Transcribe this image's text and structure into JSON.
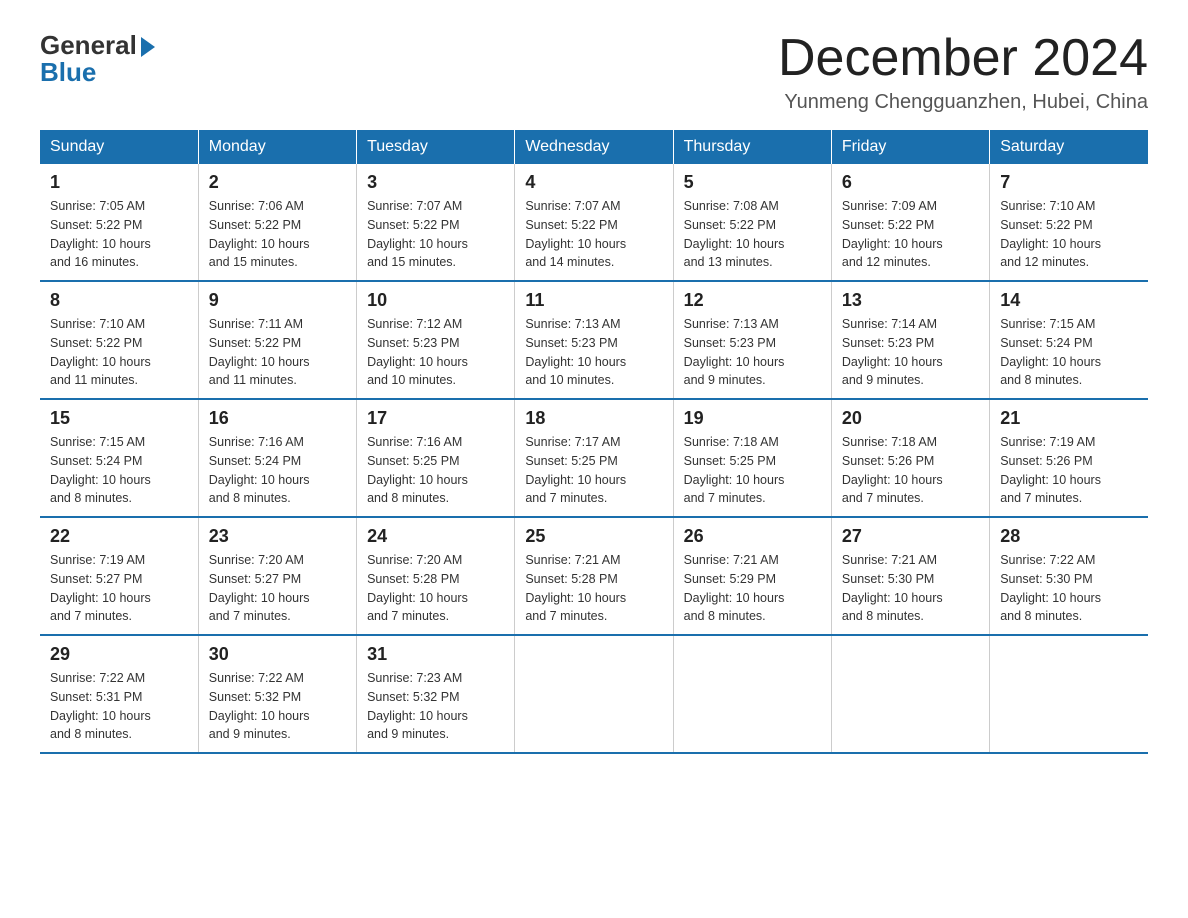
{
  "logo": {
    "general": "General",
    "blue": "Blue"
  },
  "header": {
    "month_year": "December 2024",
    "location": "Yunmeng Chengguanzhen, Hubei, China"
  },
  "weekdays": [
    "Sunday",
    "Monday",
    "Tuesday",
    "Wednesday",
    "Thursday",
    "Friday",
    "Saturday"
  ],
  "weeks": [
    [
      {
        "day": "1",
        "sunrise": "7:05 AM",
        "sunset": "5:22 PM",
        "daylight": "10 hours and 16 minutes."
      },
      {
        "day": "2",
        "sunrise": "7:06 AM",
        "sunset": "5:22 PM",
        "daylight": "10 hours and 15 minutes."
      },
      {
        "day": "3",
        "sunrise": "7:07 AM",
        "sunset": "5:22 PM",
        "daylight": "10 hours and 15 minutes."
      },
      {
        "day": "4",
        "sunrise": "7:07 AM",
        "sunset": "5:22 PM",
        "daylight": "10 hours and 14 minutes."
      },
      {
        "day": "5",
        "sunrise": "7:08 AM",
        "sunset": "5:22 PM",
        "daylight": "10 hours and 13 minutes."
      },
      {
        "day": "6",
        "sunrise": "7:09 AM",
        "sunset": "5:22 PM",
        "daylight": "10 hours and 12 minutes."
      },
      {
        "day": "7",
        "sunrise": "7:10 AM",
        "sunset": "5:22 PM",
        "daylight": "10 hours and 12 minutes."
      }
    ],
    [
      {
        "day": "8",
        "sunrise": "7:10 AM",
        "sunset": "5:22 PM",
        "daylight": "10 hours and 11 minutes."
      },
      {
        "day": "9",
        "sunrise": "7:11 AM",
        "sunset": "5:22 PM",
        "daylight": "10 hours and 11 minutes."
      },
      {
        "day": "10",
        "sunrise": "7:12 AM",
        "sunset": "5:23 PM",
        "daylight": "10 hours and 10 minutes."
      },
      {
        "day": "11",
        "sunrise": "7:13 AM",
        "sunset": "5:23 PM",
        "daylight": "10 hours and 10 minutes."
      },
      {
        "day": "12",
        "sunrise": "7:13 AM",
        "sunset": "5:23 PM",
        "daylight": "10 hours and 9 minutes."
      },
      {
        "day": "13",
        "sunrise": "7:14 AM",
        "sunset": "5:23 PM",
        "daylight": "10 hours and 9 minutes."
      },
      {
        "day": "14",
        "sunrise": "7:15 AM",
        "sunset": "5:24 PM",
        "daylight": "10 hours and 8 minutes."
      }
    ],
    [
      {
        "day": "15",
        "sunrise": "7:15 AM",
        "sunset": "5:24 PM",
        "daylight": "10 hours and 8 minutes."
      },
      {
        "day": "16",
        "sunrise": "7:16 AM",
        "sunset": "5:24 PM",
        "daylight": "10 hours and 8 minutes."
      },
      {
        "day": "17",
        "sunrise": "7:16 AM",
        "sunset": "5:25 PM",
        "daylight": "10 hours and 8 minutes."
      },
      {
        "day": "18",
        "sunrise": "7:17 AM",
        "sunset": "5:25 PM",
        "daylight": "10 hours and 7 minutes."
      },
      {
        "day": "19",
        "sunrise": "7:18 AM",
        "sunset": "5:25 PM",
        "daylight": "10 hours and 7 minutes."
      },
      {
        "day": "20",
        "sunrise": "7:18 AM",
        "sunset": "5:26 PM",
        "daylight": "10 hours and 7 minutes."
      },
      {
        "day": "21",
        "sunrise": "7:19 AM",
        "sunset": "5:26 PM",
        "daylight": "10 hours and 7 minutes."
      }
    ],
    [
      {
        "day": "22",
        "sunrise": "7:19 AM",
        "sunset": "5:27 PM",
        "daylight": "10 hours and 7 minutes."
      },
      {
        "day": "23",
        "sunrise": "7:20 AM",
        "sunset": "5:27 PM",
        "daylight": "10 hours and 7 minutes."
      },
      {
        "day": "24",
        "sunrise": "7:20 AM",
        "sunset": "5:28 PM",
        "daylight": "10 hours and 7 minutes."
      },
      {
        "day": "25",
        "sunrise": "7:21 AM",
        "sunset": "5:28 PM",
        "daylight": "10 hours and 7 minutes."
      },
      {
        "day": "26",
        "sunrise": "7:21 AM",
        "sunset": "5:29 PM",
        "daylight": "10 hours and 8 minutes."
      },
      {
        "day": "27",
        "sunrise": "7:21 AM",
        "sunset": "5:30 PM",
        "daylight": "10 hours and 8 minutes."
      },
      {
        "day": "28",
        "sunrise": "7:22 AM",
        "sunset": "5:30 PM",
        "daylight": "10 hours and 8 minutes."
      }
    ],
    [
      {
        "day": "29",
        "sunrise": "7:22 AM",
        "sunset": "5:31 PM",
        "daylight": "10 hours and 8 minutes."
      },
      {
        "day": "30",
        "sunrise": "7:22 AM",
        "sunset": "5:32 PM",
        "daylight": "10 hours and 9 minutes."
      },
      {
        "day": "31",
        "sunrise": "7:23 AM",
        "sunset": "5:32 PM",
        "daylight": "10 hours and 9 minutes."
      },
      null,
      null,
      null,
      null
    ]
  ],
  "labels": {
    "sunrise_prefix": "Sunrise: ",
    "sunset_prefix": "Sunset: ",
    "daylight_prefix": "Daylight: "
  }
}
